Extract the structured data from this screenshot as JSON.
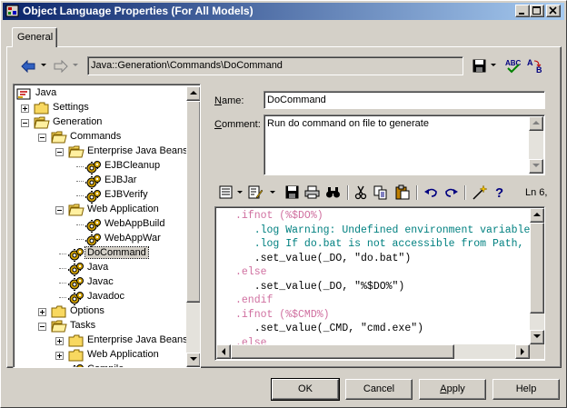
{
  "window": {
    "title": "Object Language Properties (For All Models)"
  },
  "tabs": [
    {
      "label": "General"
    }
  ],
  "nav": {
    "path": "Java::Generation\\Commands\\DoCommand"
  },
  "tree": {
    "items": [
      {
        "label": "Java",
        "level": 0,
        "icon": "java-root-icon"
      },
      {
        "label": "Settings",
        "level": 1,
        "icon": "folder-icon",
        "expander": "plus"
      },
      {
        "label": "Generation",
        "level": 1,
        "icon": "folder-open-icon",
        "expander": "minus"
      },
      {
        "label": "Commands",
        "level": 2,
        "icon": "folder-open-icon",
        "expander": "minus"
      },
      {
        "label": "Enterprise Java Beans",
        "level": 3,
        "icon": "folder-open-icon",
        "expander": "minus"
      },
      {
        "label": "EJBCleanup",
        "level": 4,
        "icon": "gear-icon"
      },
      {
        "label": "EJBJar",
        "level": 4,
        "icon": "gear-icon"
      },
      {
        "label": "EJBVerify",
        "level": 4,
        "icon": "gear-icon"
      },
      {
        "label": "Web Application",
        "level": 3,
        "icon": "folder-open-icon",
        "expander": "minus"
      },
      {
        "label": "WebAppBuild",
        "level": 4,
        "icon": "gear-icon"
      },
      {
        "label": "WebAppWar",
        "level": 4,
        "icon": "gear-icon"
      },
      {
        "label": "DoCommand",
        "level": 3,
        "icon": "gear-icon",
        "selected": true
      },
      {
        "label": "Java",
        "level": 3,
        "icon": "gear-icon"
      },
      {
        "label": "Javac",
        "level": 3,
        "icon": "gear-icon"
      },
      {
        "label": "Javadoc",
        "level": 3,
        "icon": "gear-icon"
      },
      {
        "label": "Options",
        "level": 2,
        "icon": "folder-icon",
        "expander": "plus"
      },
      {
        "label": "Tasks",
        "level": 2,
        "icon": "folder-open-icon",
        "expander": "minus"
      },
      {
        "label": "Enterprise Java Beans",
        "level": 3,
        "icon": "folder-icon",
        "expander": "plus"
      },
      {
        "label": "Web Application",
        "level": 3,
        "icon": "folder-icon",
        "expander": "plus"
      },
      {
        "label": "Compile",
        "level": 3,
        "icon": "gear-icon"
      }
    ]
  },
  "details": {
    "name_label_u": "N",
    "name_label_rest": "ame:",
    "name_value": "DoCommand",
    "comment_label_u": "C",
    "comment_label_rest": "omment:",
    "comment_value": "Run do command on file to generate",
    "editor_position": "Ln 6,"
  },
  "code": [
    [
      {
        "t": ".ifnot (%$DO%)",
        "c": "kw"
      }
    ],
    [
      {
        "t": "   .log Warning: Undefined environment variable",
        "c": "mac"
      }
    ],
    [
      {
        "t": "   .log If do.bat is not accessible from Path,",
        "c": "mac"
      }
    ],
    [
      {
        "t": "   .set_value(_DO, \"do.bat\")",
        "c": "str"
      }
    ],
    [
      {
        "t": ".else",
        "c": "kw"
      }
    ],
    [
      {
        "t": "   .set_value(_DO, \"%$DO%\")",
        "c": "str"
      }
    ],
    [
      {
        "t": ".endif",
        "c": "kw"
      }
    ],
    [
      {
        "t": ".ifnot (%$CMD%)",
        "c": "kw"
      }
    ],
    [
      {
        "t": "   .set_value(_CMD, \"cmd.exe\")",
        "c": "str"
      }
    ],
    [
      {
        "t": ".else",
        "c": "kw"
      }
    ]
  ],
  "buttons": {
    "ok": "OK",
    "cancel": "Cancel",
    "apply_u": "A",
    "apply_rest": "pply",
    "help": "Help"
  },
  "colors": {
    "title_start": "#0a246a",
    "title_end": "#a6caf0",
    "keyword": "#d070a0",
    "macro": "#008080",
    "face": "#d4d0c8"
  }
}
